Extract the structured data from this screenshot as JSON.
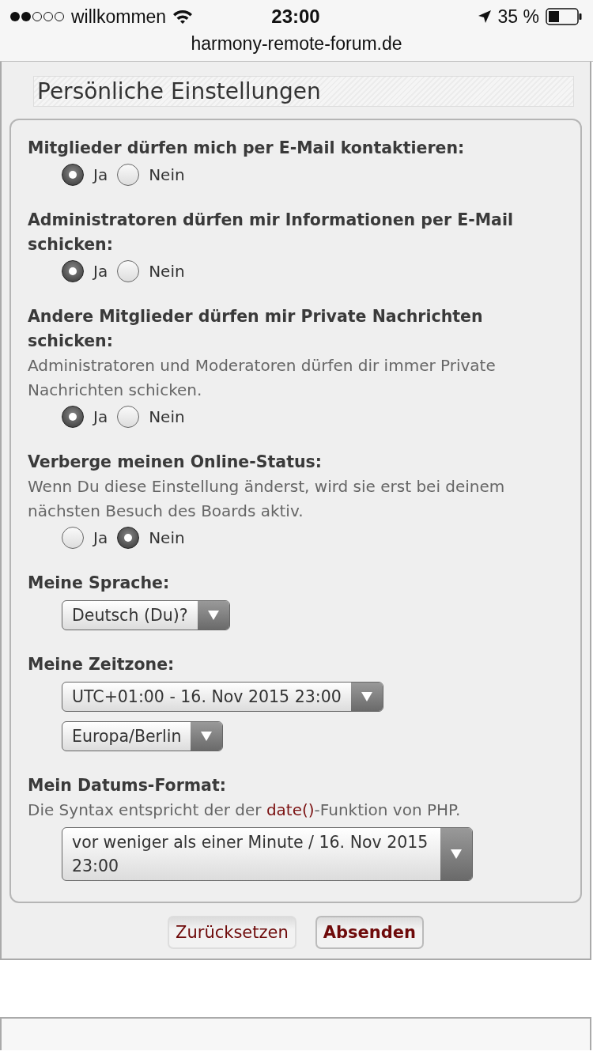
{
  "status_bar": {
    "carrier": "willkommen",
    "time": "23:00",
    "battery": "35 %",
    "url": "harmony-remote-forum.de"
  },
  "section_title": "Persönliche Einstellungen",
  "settings": [
    {
      "kind": "radio",
      "label": "Mitglieder dürfen mich per E-Mail kontaktieren:",
      "options": [
        {
          "label": "Ja",
          "selected": true
        },
        {
          "label": "Nein",
          "selected": false
        }
      ]
    },
    {
      "kind": "radio",
      "label": "Administratoren dürfen mir Informationen per E-Mail schicken:",
      "options": [
        {
          "label": "Ja",
          "selected": true
        },
        {
          "label": "Nein",
          "selected": false
        }
      ]
    },
    {
      "kind": "radio",
      "label": "Andere Mitglieder dürfen mir Private Nachrichten schicken:",
      "description": "Administratoren und Moderatoren dürfen dir immer Private Nachrichten schicken.",
      "options": [
        {
          "label": "Ja",
          "selected": true
        },
        {
          "label": "Nein",
          "selected": false
        }
      ]
    },
    {
      "kind": "radio",
      "label": "Verberge meinen Online-Status:",
      "description": "Wenn Du diese Einstellung änderst, wird sie erst bei deinem nächsten Besuch des Boards aktiv.",
      "options": [
        {
          "label": "Ja",
          "selected": false
        },
        {
          "label": "Nein",
          "selected": true
        }
      ]
    },
    {
      "kind": "select",
      "label": "Meine Sprache:",
      "selects": [
        "Deutsch (Du)?"
      ]
    },
    {
      "kind": "select",
      "label": "Meine Zeitzone:",
      "selects": [
        "UTC+01:00 - 16. Nov 2015 23:00",
        "Europa/Berlin"
      ]
    },
    {
      "kind": "select",
      "label": "Mein Datums-Format:",
      "description_parts": {
        "before": "Die Syntax entspricht der der ",
        "link": "date()",
        "after": "-Funktion von PHP."
      },
      "selects": [
        "vor weniger als einer Minute / 16. Nov 2015 23:00"
      ]
    }
  ],
  "buttons": [
    {
      "label": "Zurücksetzen",
      "primary": false
    },
    {
      "label": "Absenden",
      "primary": true
    }
  ]
}
